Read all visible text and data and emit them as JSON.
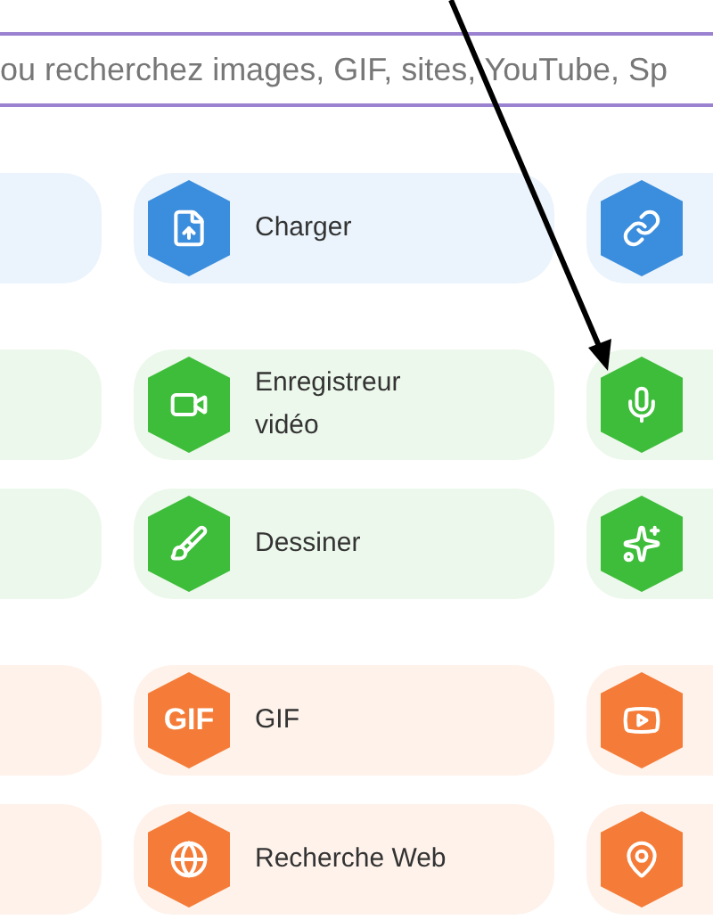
{
  "search": {
    "placeholder": "ou recherchez images, GIF, sites, YouTube, Sp"
  },
  "groups": [
    {
      "color": "#3b8ddd",
      "rows": [
        {
          "main": {
            "kind": "icon",
            "label": "Charger"
          },
          "side": {
            "kind": "icon"
          }
        }
      ]
    },
    {
      "color": "#3dbd3a",
      "rows": [
        {
          "main": {
            "kind": "icon",
            "label": "Enregistreur vidéo"
          },
          "side": {
            "kind": "icon"
          }
        },
        {
          "main": {
            "kind": "icon",
            "label": "Dessiner"
          },
          "side": {
            "kind": "icon"
          }
        }
      ]
    },
    {
      "color": "#f57c38",
      "rows": [
        {
          "main": {
            "kind": "text",
            "badge": "GIF",
            "label": "GIF"
          },
          "side": {
            "kind": "icon"
          }
        },
        {
          "main": {
            "kind": "icon",
            "label": "Recherche Web"
          },
          "side": {
            "kind": "icon"
          }
        }
      ]
    }
  ]
}
